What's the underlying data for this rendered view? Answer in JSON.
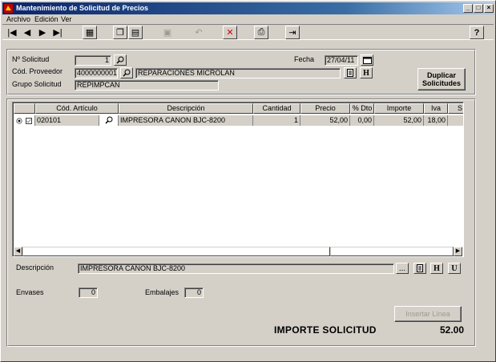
{
  "window": {
    "title": "Mantenimiento de Solicitud de Precios",
    "minimize": "_",
    "maximize": "□",
    "close": "×"
  },
  "menu": {
    "items": [
      "Archivo",
      "Edición",
      "Ver"
    ]
  },
  "toolbar": {
    "first": "|◀",
    "prev": "◀",
    "next": "▶",
    "last": "▶|",
    "calculator": "▦",
    "new": "❐",
    "list": "▤",
    "save": "▣",
    "undo": "↶",
    "delete": "✕",
    "print": "⎙",
    "exit": "⇥",
    "help": "?"
  },
  "header": {
    "solicitud_label": "Nº Solicitud",
    "solicitud_value": "1",
    "fecha_label": "Fecha",
    "fecha_value": "27/04/11",
    "proveedor_label": "Cód. Proveedor",
    "proveedor_code": "4000000001",
    "proveedor_name": "REPARACIONES MICROLAN",
    "grupo_label": "Grupo Solicitud",
    "grupo_value": "REPIMPCAN",
    "duplicar_label": "Duplicar Solicitudes",
    "h_button": "H"
  },
  "grid": {
    "columns": [
      "Cód. Artículo",
      "Descripción",
      "Cantidad",
      "Precio",
      "% Dto",
      "Importe",
      "Iva",
      "S"
    ],
    "rows": [
      {
        "codigo": "020101",
        "descripcion": "IMPRESORA CANON BJC-8200",
        "cantidad": "1",
        "precio": "52,00",
        "dto": "0,00",
        "importe": "52,00",
        "iva": "18,00"
      }
    ],
    "scroll_left": "◀",
    "scroll_right": "▶"
  },
  "detail": {
    "descripcion_label": "Descripción",
    "descripcion_value": "IMPRESORA CANON BJC-8200",
    "ellipsis": "...",
    "h_button": "H",
    "u_button": "U",
    "envases_label": "Envases",
    "envases_value": "0",
    "embalajes_label": "Embalajes",
    "embalajes_value": "0",
    "insertar_label": "Insertar Línea",
    "total_label": "IMPORTE SOLICITUD",
    "total_value": "52.00"
  },
  "colors": {
    "title_start": "#0a246a",
    "title_end": "#a6caf0",
    "face": "#d4d0c8",
    "delete_red": "#d00000"
  }
}
